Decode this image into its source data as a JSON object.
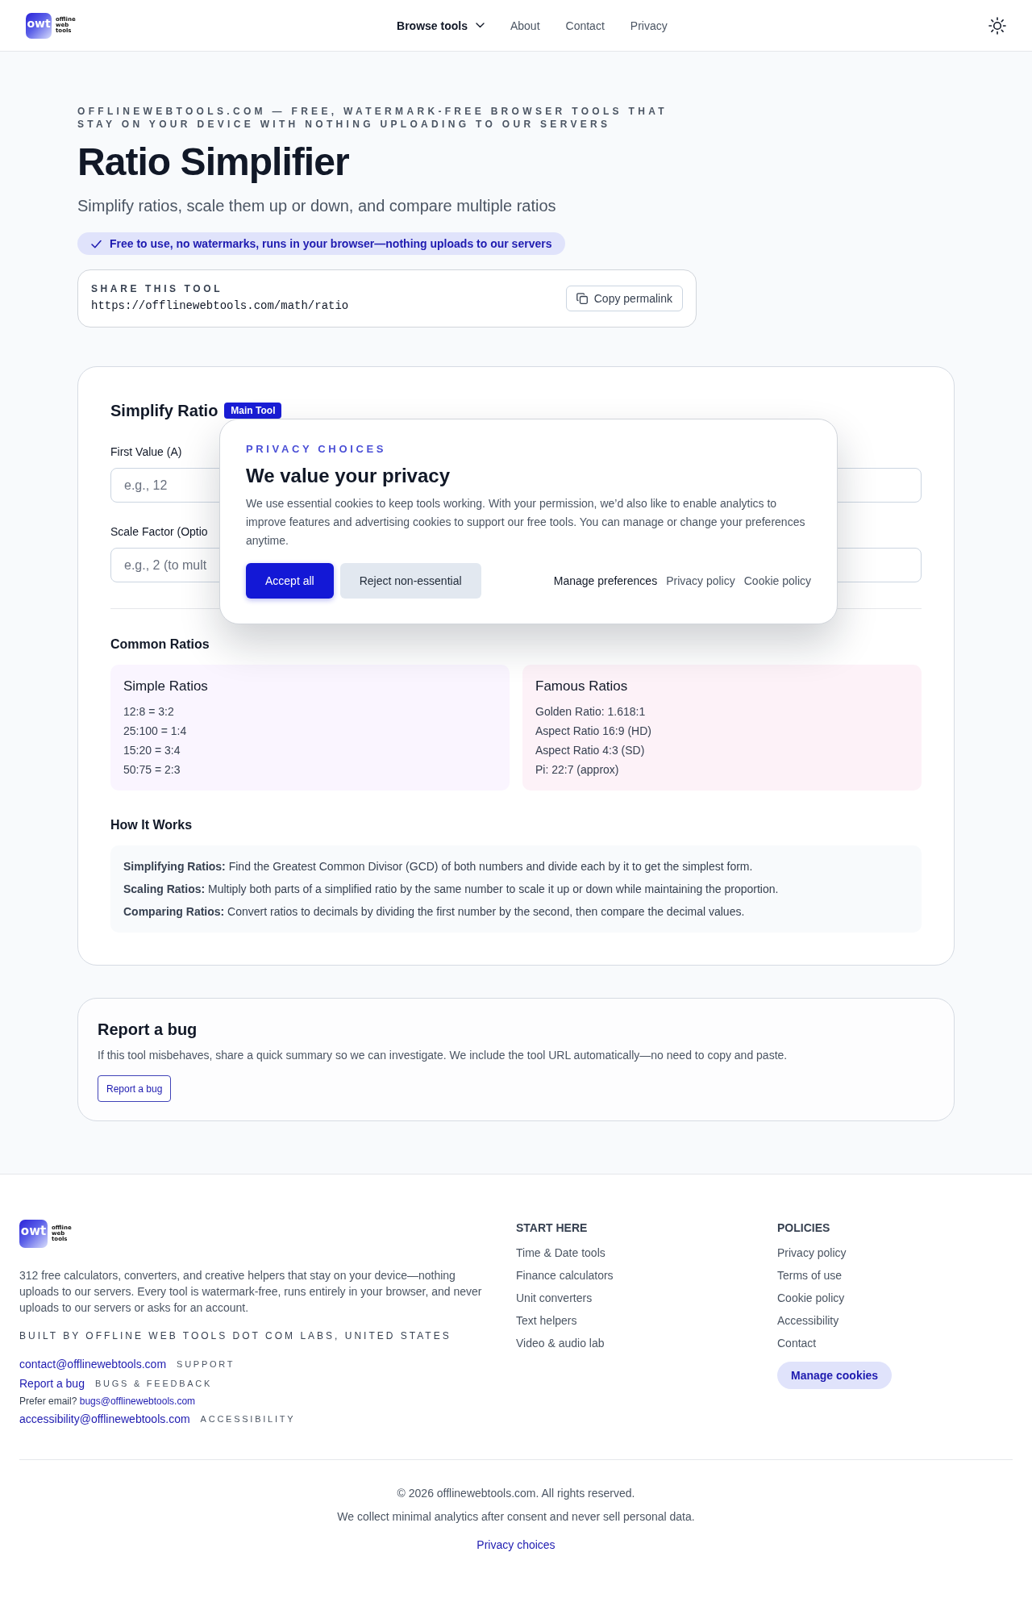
{
  "header": {
    "logo": {
      "mark": "owt",
      "wordmark": "offline web tools"
    },
    "nav": [
      {
        "label": "Browse tools",
        "kind": "menu"
      },
      {
        "label": "About",
        "kind": "link"
      },
      {
        "label": "Contact",
        "kind": "link"
      },
      {
        "label": "Privacy",
        "kind": "link"
      }
    ]
  },
  "hero": {
    "eyebrow": "OFFLINEWEBTOOLS.COM — FREE, WATERMARK-FREE BROWSER TOOLS THAT STAY ON YOUR DEVICE WITH NOTHING UPLOADING TO OUR SERVERS",
    "title": "Ratio Simplifier",
    "subtitle": "Simplify ratios, scale them up or down, and compare multiple ratios",
    "badge": "Free to use, no watermarks, runs in your browser—nothing uploads to our servers",
    "share": {
      "label": "SHARE THIS TOOL",
      "url": "https://offlinewebtools.com/math/ratio",
      "button": "Copy permalink"
    }
  },
  "tool": {
    "title": "Simplify Ratio",
    "badge": "Main Tool",
    "fields": [
      {
        "label": "First Value (A)",
        "placeholder": "e.g., 12"
      },
      {
        "label": "Scale Factor (Optio",
        "placeholder": "e.g., 2 (to mult"
      }
    ],
    "common_ratios": {
      "title": "Common Ratios",
      "groups": [
        {
          "title": "Simple Ratios",
          "color": "#faf5ff",
          "items": [
            "12:8 = 3:2",
            "25:100 = 1:4",
            "15:20 = 3:4",
            "50:75 = 2:3"
          ]
        },
        {
          "title": "Famous Ratios",
          "color": "#fdf2f8",
          "items": [
            "Golden Ratio: 1.618:1",
            "Aspect Ratio 16:9 (HD)",
            "Aspect Ratio 4:3 (SD)",
            "Pi: 22:7 (approx)"
          ]
        }
      ]
    },
    "how_it_works": {
      "title": "How It Works",
      "items": [
        "**Simplifying Ratios:** Find the Greatest Common Divisor (GCD) of both numbers and divide each by it to get the simplest form.",
        "**Scaling Ratios:** Multiply both parts of a simplified ratio by the same number to scale it up or down while maintaining the proportion.",
        "**Comparing Ratios:** Convert ratios to decimals by dividing the first number by the second, then compare the decimal values."
      ]
    }
  },
  "cookie_dialog": {
    "eyebrow": "PRIVACY CHOICES",
    "title": "We value your privacy",
    "text": "We use essential cookies to keep tools working. With your permission, we’d also like to enable analytics to improve features and advertising cookies to support our free tools. You can manage or change your preferences anytime.",
    "buttons": [
      {
        "label": "Accept all",
        "kind": "primary"
      },
      {
        "label": "Reject non-essential",
        "kind": "secondary"
      }
    ],
    "links": [
      {
        "label": "Manage preferences",
        "kind": "strong"
      },
      {
        "label": "Privacy policy",
        "kind": "plain"
      },
      {
        "label": "Cookie policy",
        "kind": "plain"
      }
    ]
  },
  "report": {
    "title": "Report a bug",
    "text": "If this tool misbehaves, share a quick summary so we can investigate. We include the tool URL automatically—no need to copy and paste.",
    "button": "Report a bug"
  },
  "footer": {
    "logo": {
      "mark": "owt",
      "wordmark": "offline web tools"
    },
    "description": "312 free calculators, converters, and creative helpers that stay on your device—nothing uploads to our servers. Every tool is watermark-free, runs entirely in your browser, and never uploads to our servers or asks for an account.",
    "built_by": "BUILT BY OFFLINE WEB TOOLS DOT COM LABS, UNITED STATES",
    "contacts": [
      {
        "kind": "email",
        "link": "contact@offlinewebtools.com",
        "tag": "SUPPORT"
      },
      {
        "kind": "bug_link",
        "link": "Report a bug",
        "tag": "BUGS & FEEDBACK"
      },
      {
        "kind": "note",
        "text": "Prefer email?",
        "link": "bugs@offlinewebtools.com"
      },
      {
        "kind": "email",
        "link": "accessibility@offlinewebtools.com",
        "tag": "ACCESSIBILITY"
      }
    ],
    "columns": [
      {
        "title": "START HERE",
        "links": [
          "Time & Date tools",
          "Finance calculators",
          "Unit converters",
          "Text helpers",
          "Video & audio lab"
        ]
      },
      {
        "title": "POLICIES",
        "links": [
          "Privacy policy",
          "Terms of use",
          "Cookie policy",
          "Accessibility",
          "Contact"
        ],
        "button": "Manage cookies"
      }
    ],
    "copyright": "© 2026 offlinewebtools.com. All rights reserved.",
    "analytics_note": "We collect minimal analytics after consent and never sell personal data.",
    "privacy_link": "Privacy choices"
  }
}
